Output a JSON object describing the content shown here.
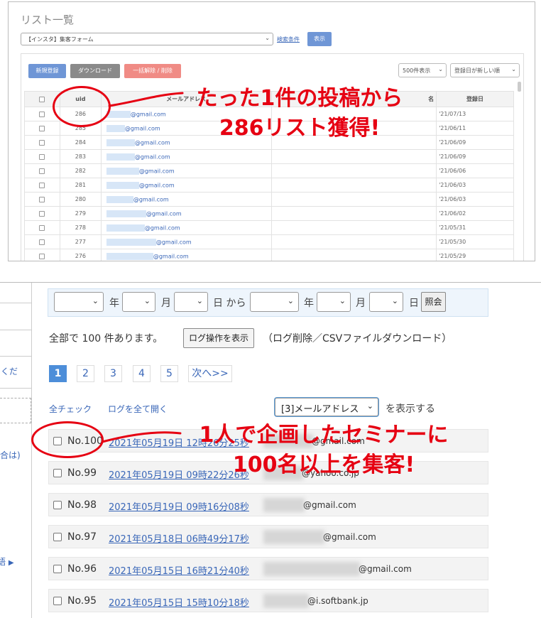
{
  "top": {
    "title": "リスト一覧",
    "form_select": "【インスタ】集客フォーム",
    "search_link": "検索条件",
    "show_button": "表示",
    "buttons": {
      "new": "新規登録",
      "download": "ダウンロード",
      "bulk": "一括解除 / 削除"
    },
    "page_size": "500件表示",
    "sort": "登録日が新しい順",
    "columns": {
      "uid": "uid",
      "email": "メールアドレス",
      "name": "名",
      "date": "登録日"
    },
    "rows": [
      {
        "uid": "286",
        "email": "@gmail.com",
        "date": "'21/07/13"
      },
      {
        "uid": "285",
        "email": "@gmail.com",
        "date": "'21/06/11"
      },
      {
        "uid": "284",
        "email": "@gmail.com",
        "date": "'21/06/09"
      },
      {
        "uid": "283",
        "email": "@gmail.com",
        "date": "'21/06/09"
      },
      {
        "uid": "282",
        "email": "@gmail.com",
        "date": "'21/06/06"
      },
      {
        "uid": "281",
        "email": "@gmail.com",
        "date": "'21/06/03"
      },
      {
        "uid": "280",
        "email": "@gmail.com",
        "date": "'21/06/03"
      },
      {
        "uid": "279",
        "email": "@gmail.com",
        "date": "'21/06/02"
      },
      {
        "uid": "278",
        "email": "@gmail.com",
        "date": "'21/05/31"
      },
      {
        "uid": "277",
        "email": "@gmail.com",
        "date": "'21/05/30"
      },
      {
        "uid": "276",
        "email": "@gmail.com",
        "date": "'21/05/29"
      }
    ],
    "annotation": [
      "たった1件の投稿から",
      "286リスト獲得!"
    ]
  },
  "bottom": {
    "sidebar": {
      "text1": "くだ",
      "text2": "合は)",
      "text3": "語"
    },
    "filter": {
      "year": "年",
      "month": "月",
      "day_from": "日 から",
      "year2": "年",
      "month2": "月",
      "day2": "日",
      "query_button": "照会"
    },
    "count_text": "全部で 100 件あります。",
    "log_button": "ログ操作を表示",
    "log_note": "（ログ削除／CSVファイルダウンロード）",
    "pages": [
      "1",
      "2",
      "3",
      "4",
      "5"
    ],
    "next": "次へ>>",
    "check_all": "全チェック",
    "open_all": "ログを全て開く",
    "field_select": "[3]メールアドレス",
    "show_suffix": "を表示する",
    "rows": [
      {
        "no": "No.100",
        "datetime": "2021年05月19日 12時26分25秒",
        "domain": "@gmail.com"
      },
      {
        "no": "No.99",
        "datetime": "2021年05月19日 09時22分26秒",
        "domain": "@yahoo.co.jp"
      },
      {
        "no": "No.98",
        "datetime": "2021年05月19日 09時16分08秒",
        "domain": "@gmail.com"
      },
      {
        "no": "No.97",
        "datetime": "2021年05月18日 06時49分17秒",
        "domain": "@gmail.com"
      },
      {
        "no": "No.96",
        "datetime": "2021年05月15日 16時21分40秒",
        "domain": "@gmail.com"
      },
      {
        "no": "No.95",
        "datetime": "2021年05月15日 15時10分18秒",
        "domain": "@i.softbank.jp"
      }
    ],
    "annotation": [
      "1人で企画したセミナーに",
      "100名以上を集客!"
    ]
  }
}
